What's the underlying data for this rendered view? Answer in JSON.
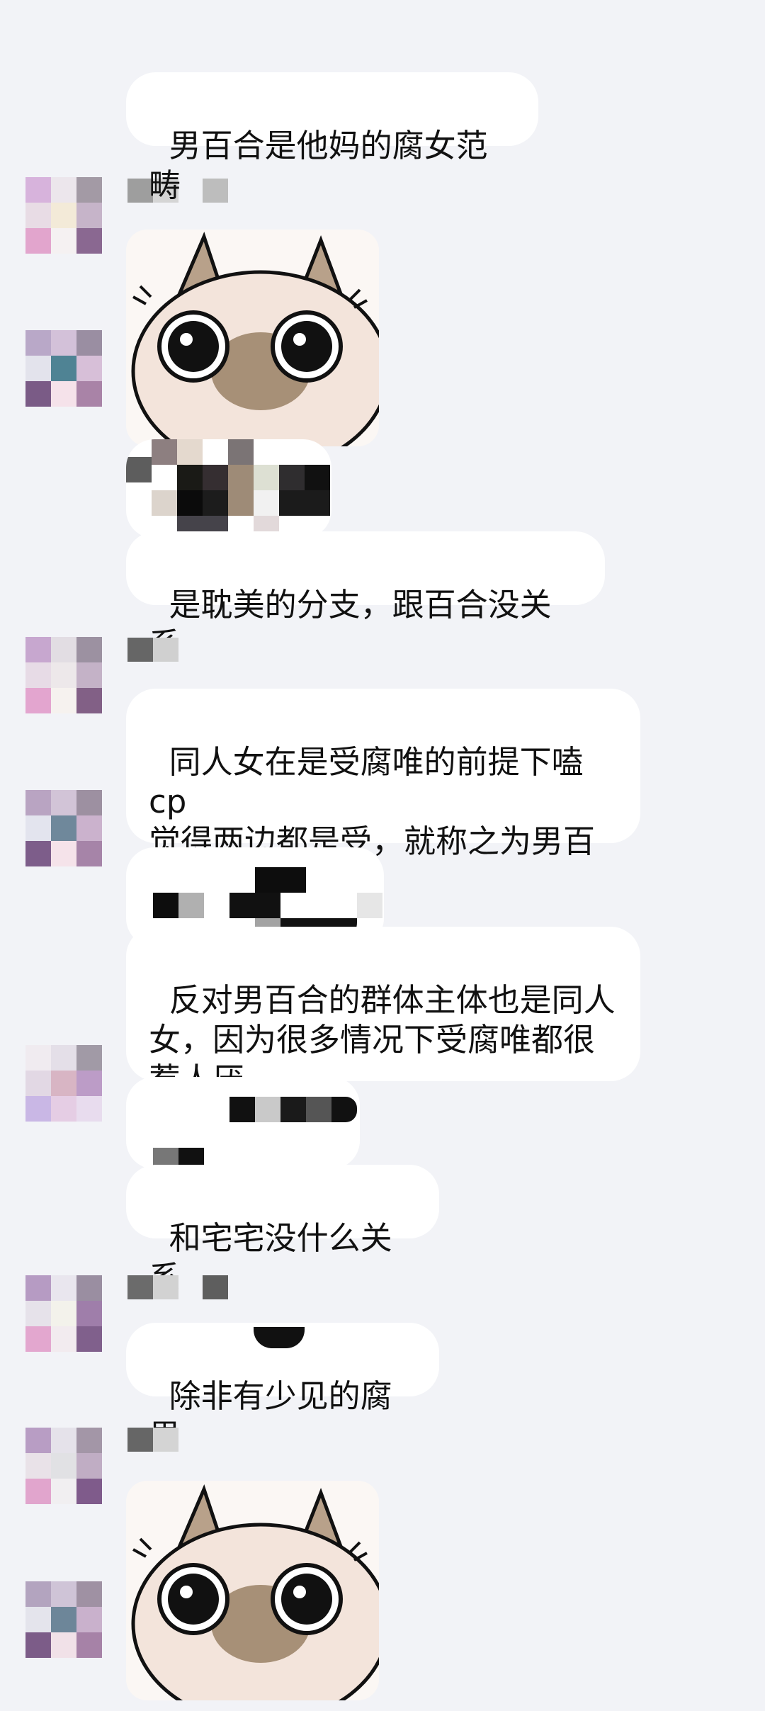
{
  "chat": {
    "messages": [
      {
        "text": "男百合是他妈的腐女范畴"
      },
      {
        "text": "是耽美的分支，跟百合没关系"
      },
      {
        "text": "同人女在是受腐唯的前提下嗑cp\n觉得两边都是受，就称之为男百\n合"
      },
      {
        "text": "反对男百合的群体主体也是同人\n女，因为很多情况下受腐唯都很\n惹人厌"
      },
      {
        "text": "和宅宅没什么关系"
      },
      {
        "text": "除非有少见的腐男"
      }
    ],
    "stickers": [
      {
        "name": "siamese-cat-sticker"
      },
      {
        "name": "siamese-cat-sticker"
      }
    ]
  },
  "colors": {
    "background": "#f2f3f7",
    "bubble": "#ffffff",
    "text": "#111111",
    "cat_face": "#f3e4db",
    "cat_ear": "#b8a18a"
  }
}
